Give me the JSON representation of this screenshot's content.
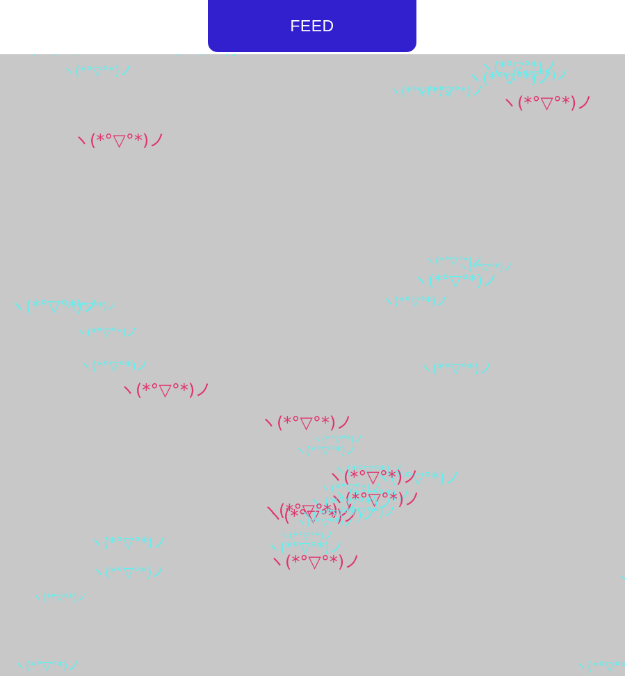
{
  "feed_button": {
    "label": "FEED"
  },
  "colors": {
    "button_bg": "#3220cf",
    "field_bg": "#c8c8c8",
    "fed_face": "#e0336c",
    "hungry_face": "#5df0f0"
  },
  "kaomoji": "ヽ(*°▽°*)ノ"
}
